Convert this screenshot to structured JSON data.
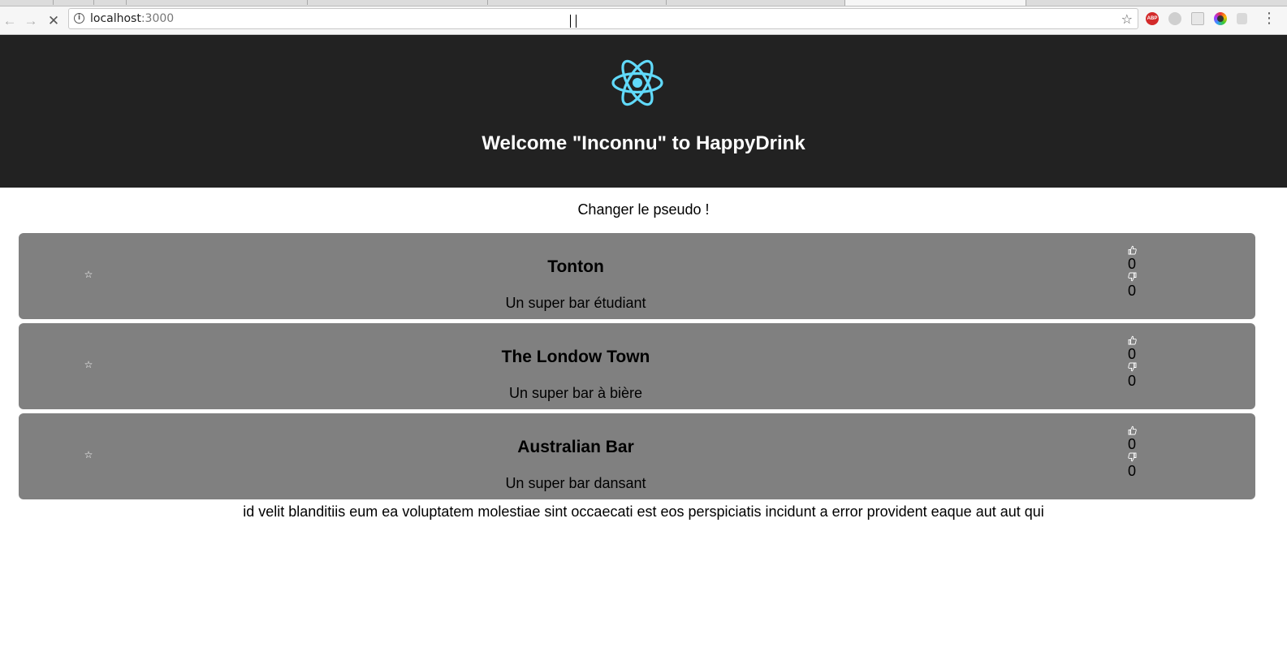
{
  "browser": {
    "url_host": "localhost",
    "url_port": ":3000",
    "extensions": [
      "ABP",
      "gray-extension-icon",
      "grid-extension-icon",
      "color-wheel-extension-icon",
      "shield-extension-icon"
    ]
  },
  "header": {
    "logo": "react-logo-icon",
    "title": "Welcome \"Inconnu\" to HappyDrink",
    "colors": {
      "background": "#222222",
      "logo": "#61dafb",
      "title": "#ffffff"
    }
  },
  "change_pseudo_label": "Changer le pseudo !",
  "bars": [
    {
      "name": "Tonton",
      "description": "Un super bar étudiant",
      "likes": "0",
      "dislikes": "0"
    },
    {
      "name": "The Londow Town",
      "description": "Un super bar à bière",
      "likes": "0",
      "dislikes": "0"
    },
    {
      "name": "Australian Bar",
      "description": "Un super bar dansant",
      "likes": "0",
      "dislikes": "0"
    }
  ],
  "card_color": "#808080",
  "footer_text": "id velit blanditiis eum ea voluptatem molestiae sint occaecati est eos perspiciatis incidunt a error provident eaque aut aut qui"
}
